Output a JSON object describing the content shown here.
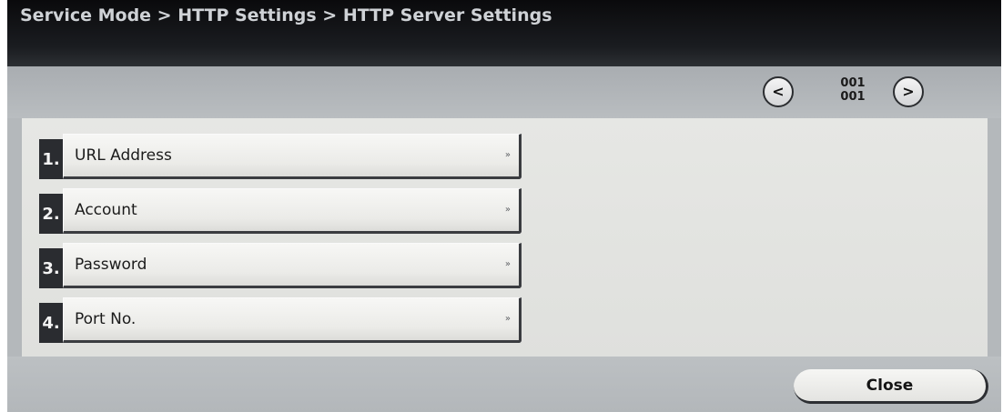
{
  "header": {
    "breadcrumb": "Service Mode > HTTP Settings > HTTP Server Settings"
  },
  "pager": {
    "prev_icon": "<",
    "next_icon": ">",
    "current_page": "001",
    "total_pages": "001"
  },
  "menu": {
    "items": [
      {
        "number": "1.",
        "label": "URL Address",
        "arrow": "»"
      },
      {
        "number": "2.",
        "label": "Account",
        "arrow": "»"
      },
      {
        "number": "3.",
        "label": "Password",
        "arrow": "»"
      },
      {
        "number": "4.",
        "label": "Port No.",
        "arrow": "»"
      }
    ]
  },
  "footer": {
    "close_label": "Close"
  },
  "colors": {
    "header_bg": "#0a0a0c",
    "panel_bg": "#e6e7e4",
    "frame_bg": "#b4b8bb",
    "number_badge_bg": "#2a2c30"
  }
}
